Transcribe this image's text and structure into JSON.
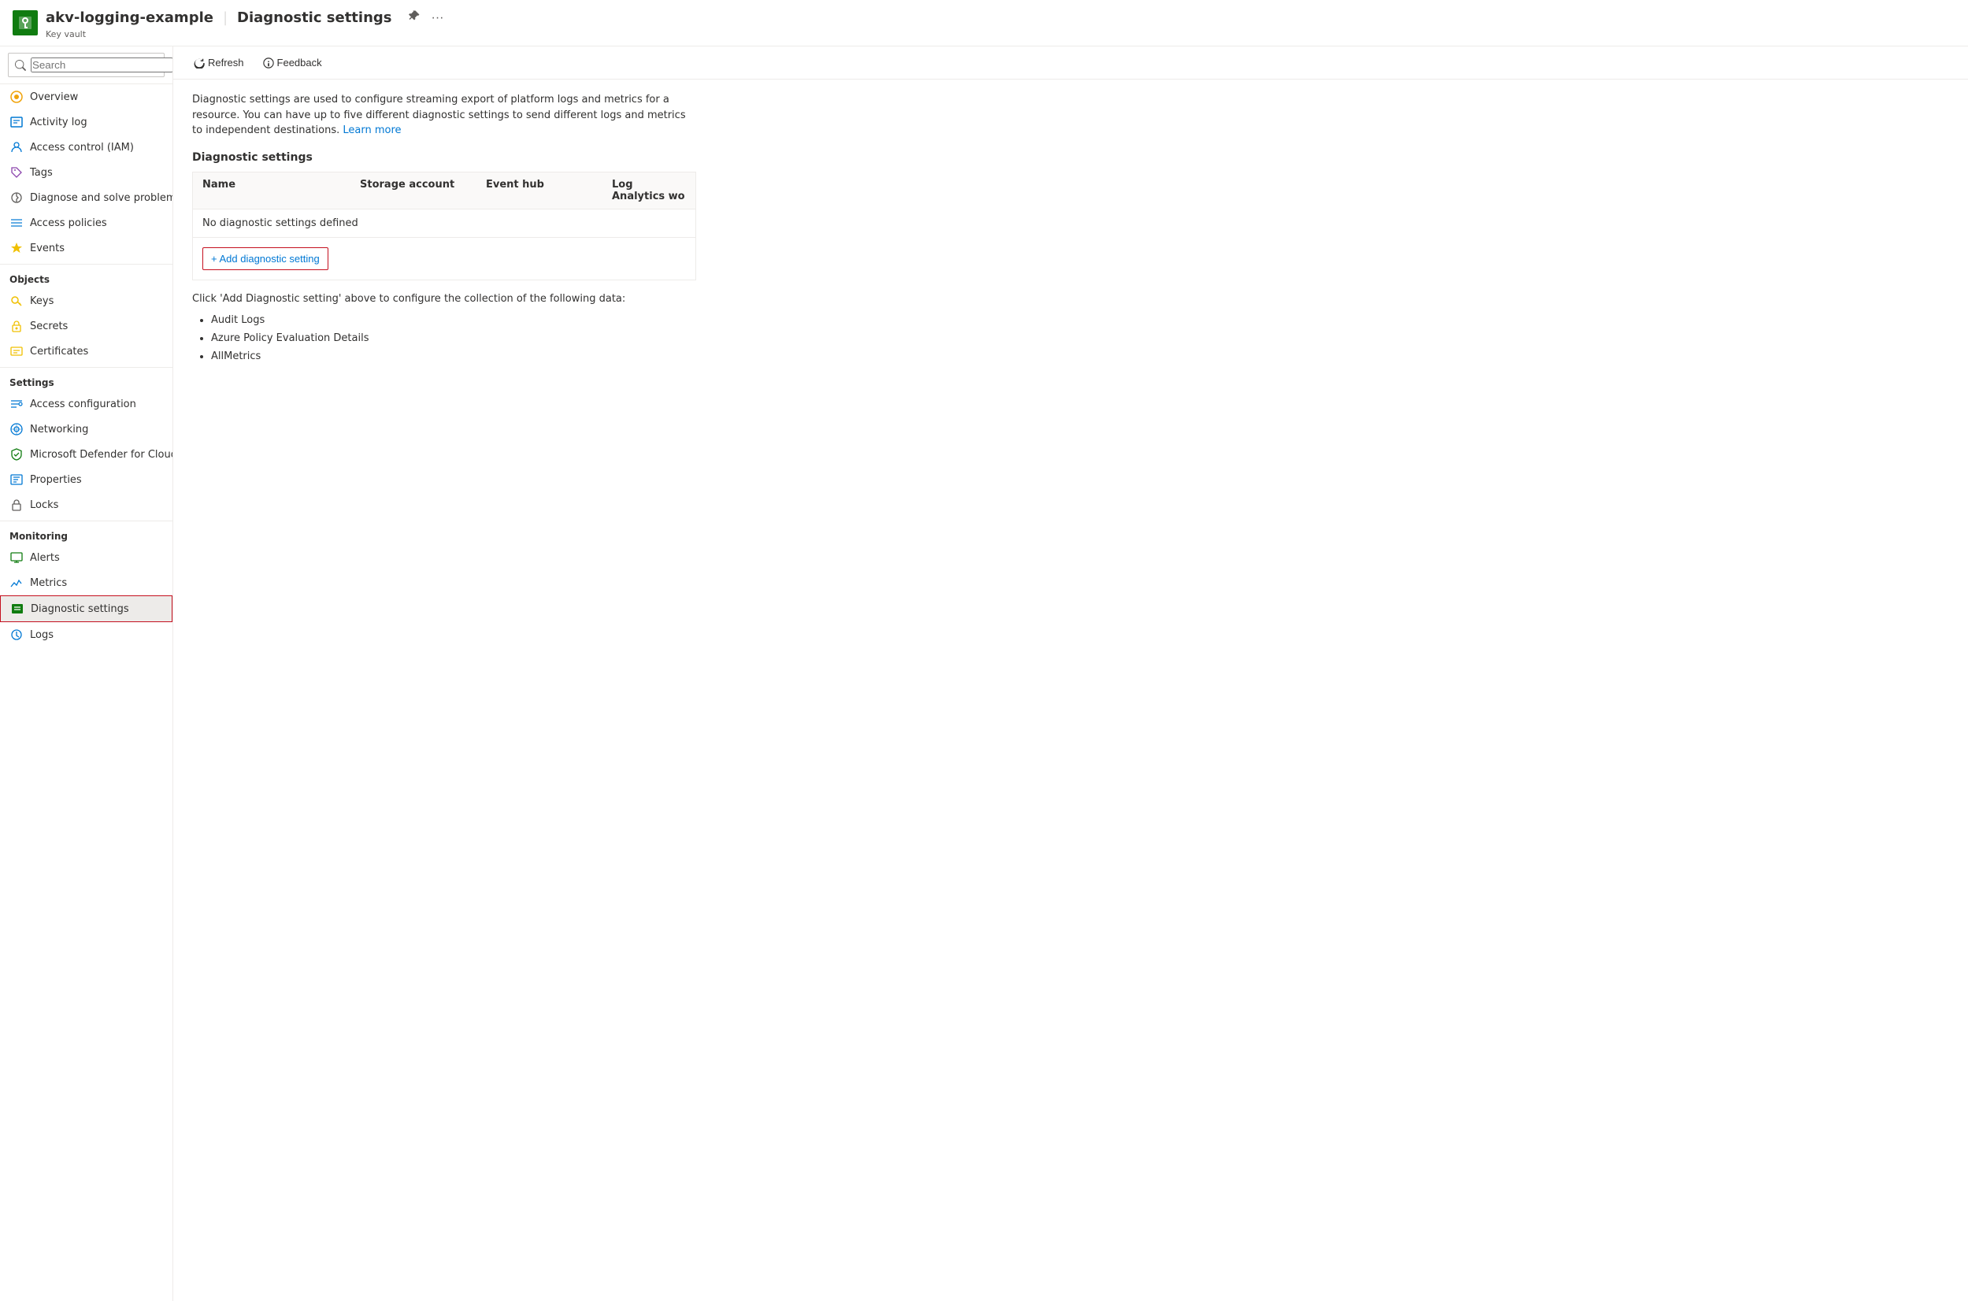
{
  "header": {
    "icon_label": "key-vault-icon",
    "title": "akv-logging-example",
    "separator": "|",
    "page": "Diagnostic settings",
    "subtitle": "Key vault"
  },
  "sidebar": {
    "search_placeholder": "Search",
    "items": [
      {
        "id": "overview",
        "label": "Overview",
        "icon": "overview-icon"
      },
      {
        "id": "activity-log",
        "label": "Activity log",
        "icon": "activity-log-icon"
      },
      {
        "id": "access-control",
        "label": "Access control (IAM)",
        "icon": "iam-icon"
      },
      {
        "id": "tags",
        "label": "Tags",
        "icon": "tags-icon"
      },
      {
        "id": "diagnose",
        "label": "Diagnose and solve problems",
        "icon": "diagnose-icon"
      },
      {
        "id": "access-policies",
        "label": "Access policies",
        "icon": "access-policies-icon"
      },
      {
        "id": "events",
        "label": "Events",
        "icon": "events-icon"
      }
    ],
    "sections": [
      {
        "title": "Objects",
        "items": [
          {
            "id": "keys",
            "label": "Keys",
            "icon": "keys-icon"
          },
          {
            "id": "secrets",
            "label": "Secrets",
            "icon": "secrets-icon"
          },
          {
            "id": "certificates",
            "label": "Certificates",
            "icon": "certificates-icon"
          }
        ]
      },
      {
        "title": "Settings",
        "items": [
          {
            "id": "access-config",
            "label": "Access configuration",
            "icon": "access-config-icon"
          },
          {
            "id": "networking",
            "label": "Networking",
            "icon": "networking-icon"
          },
          {
            "id": "defender",
            "label": "Microsoft Defender for Cloud",
            "icon": "defender-icon"
          },
          {
            "id": "properties",
            "label": "Properties",
            "icon": "properties-icon"
          },
          {
            "id": "locks",
            "label": "Locks",
            "icon": "locks-icon"
          }
        ]
      },
      {
        "title": "Monitoring",
        "items": [
          {
            "id": "alerts",
            "label": "Alerts",
            "icon": "alerts-icon"
          },
          {
            "id": "metrics",
            "label": "Metrics",
            "icon": "metrics-icon"
          },
          {
            "id": "diagnostic-settings",
            "label": "Diagnostic settings",
            "icon": "diagnostic-settings-icon",
            "active": true
          },
          {
            "id": "logs",
            "label": "Logs",
            "icon": "logs-icon"
          }
        ]
      }
    ]
  },
  "toolbar": {
    "refresh_label": "Refresh",
    "feedback_label": "Feedback"
  },
  "content": {
    "description": "Diagnostic settings are used to configure streaming export of platform logs and metrics for a resource. You can have up to five different diagnostic settings to send different logs and metrics to independent destinations.",
    "learn_more": "Learn more",
    "section_title": "Diagnostic settings",
    "table_columns": [
      "Name",
      "Storage account",
      "Event hub",
      "Log Analytics wo"
    ],
    "empty_message": "No diagnostic settings defined",
    "add_button_label": "+ Add diagnostic setting",
    "collection_intro": "Click 'Add Diagnostic setting' above to configure the collection of the following data:",
    "data_items": [
      "Audit Logs",
      "Azure Policy Evaluation Details",
      "AllMetrics"
    ]
  }
}
